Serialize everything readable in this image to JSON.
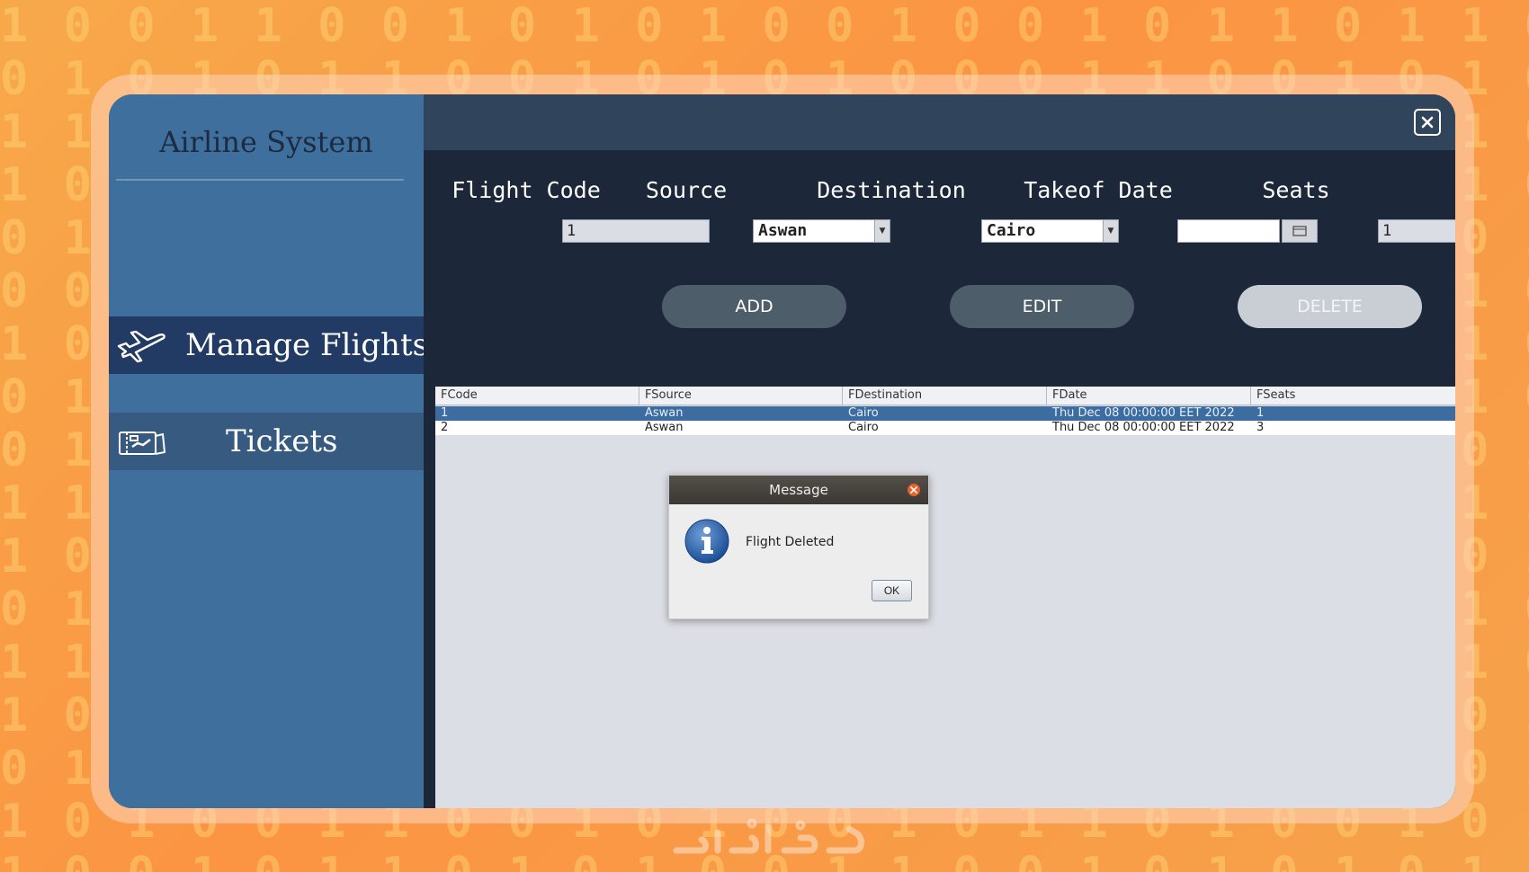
{
  "app": {
    "title": "Airline System",
    "nav": [
      {
        "label": "Manage Flights",
        "icon": "airplane-icon",
        "active": true
      },
      {
        "label": "Tickets",
        "icon": "ticket-icon",
        "active": false
      }
    ],
    "close_icon": "close-icon"
  },
  "form": {
    "flight_code": {
      "label": "Flight Code",
      "value": "1"
    },
    "source": {
      "label": "Source",
      "value": "Aswan"
    },
    "destination": {
      "label": "Destination",
      "value": "Cairo"
    },
    "takeoff_date": {
      "label": "Takeof Date",
      "value": ""
    },
    "seats": {
      "label": "Seats",
      "value": "1"
    }
  },
  "buttons": {
    "add": "ADD",
    "edit": "EDIT",
    "delete": "DELETE"
  },
  "table": {
    "columns": [
      "FCode",
      "FSource",
      "FDestination",
      "FDate",
      "FSeats"
    ],
    "rows": [
      {
        "code": "1",
        "source": "Aswan",
        "destination": "Cairo",
        "date": "Thu Dec 08 00:00:00 EET 2022",
        "seats": "1",
        "selected": true
      },
      {
        "code": "2",
        "source": "Aswan",
        "destination": "Cairo",
        "date": "Thu Dec 08 00:00:00 EET 2022",
        "seats": "3",
        "selected": false
      }
    ]
  },
  "dialog": {
    "title": "Message",
    "message": "Flight Deleted",
    "ok": "OK",
    "icon": "info-icon"
  },
  "colors": {
    "sidebar": "#3f709d",
    "active_nav": "#223b65",
    "main_panel": "#1c273a",
    "selected_row": "#3d6da0",
    "background_orange": "#fb9443"
  }
}
